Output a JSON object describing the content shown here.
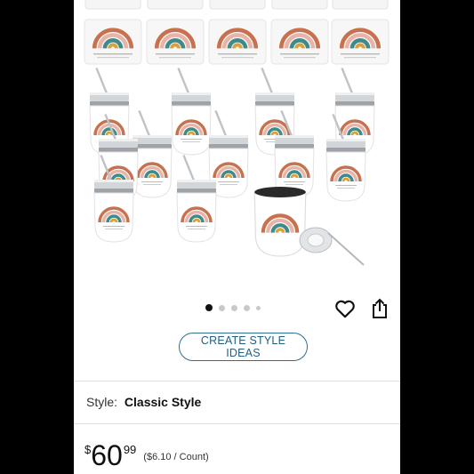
{
  "carousel": {
    "dot_count": 5,
    "active_index": 0
  },
  "actions": {
    "create_style_ideas": "CREATE STYLE IDEAS"
  },
  "style": {
    "label": "Style:",
    "value": "Classic Style"
  },
  "price": {
    "currency": "$",
    "whole": "60",
    "fraction": "99",
    "per_unit": "($6.10 / Count)"
  },
  "colors": {
    "accent": "#2b6f91",
    "rainbow_terracotta": "#c8714f",
    "rainbow_teal": "#3f8a8a",
    "rainbow_mustard": "#d9a13b",
    "rainbow_blush": "#e9b4a8"
  }
}
